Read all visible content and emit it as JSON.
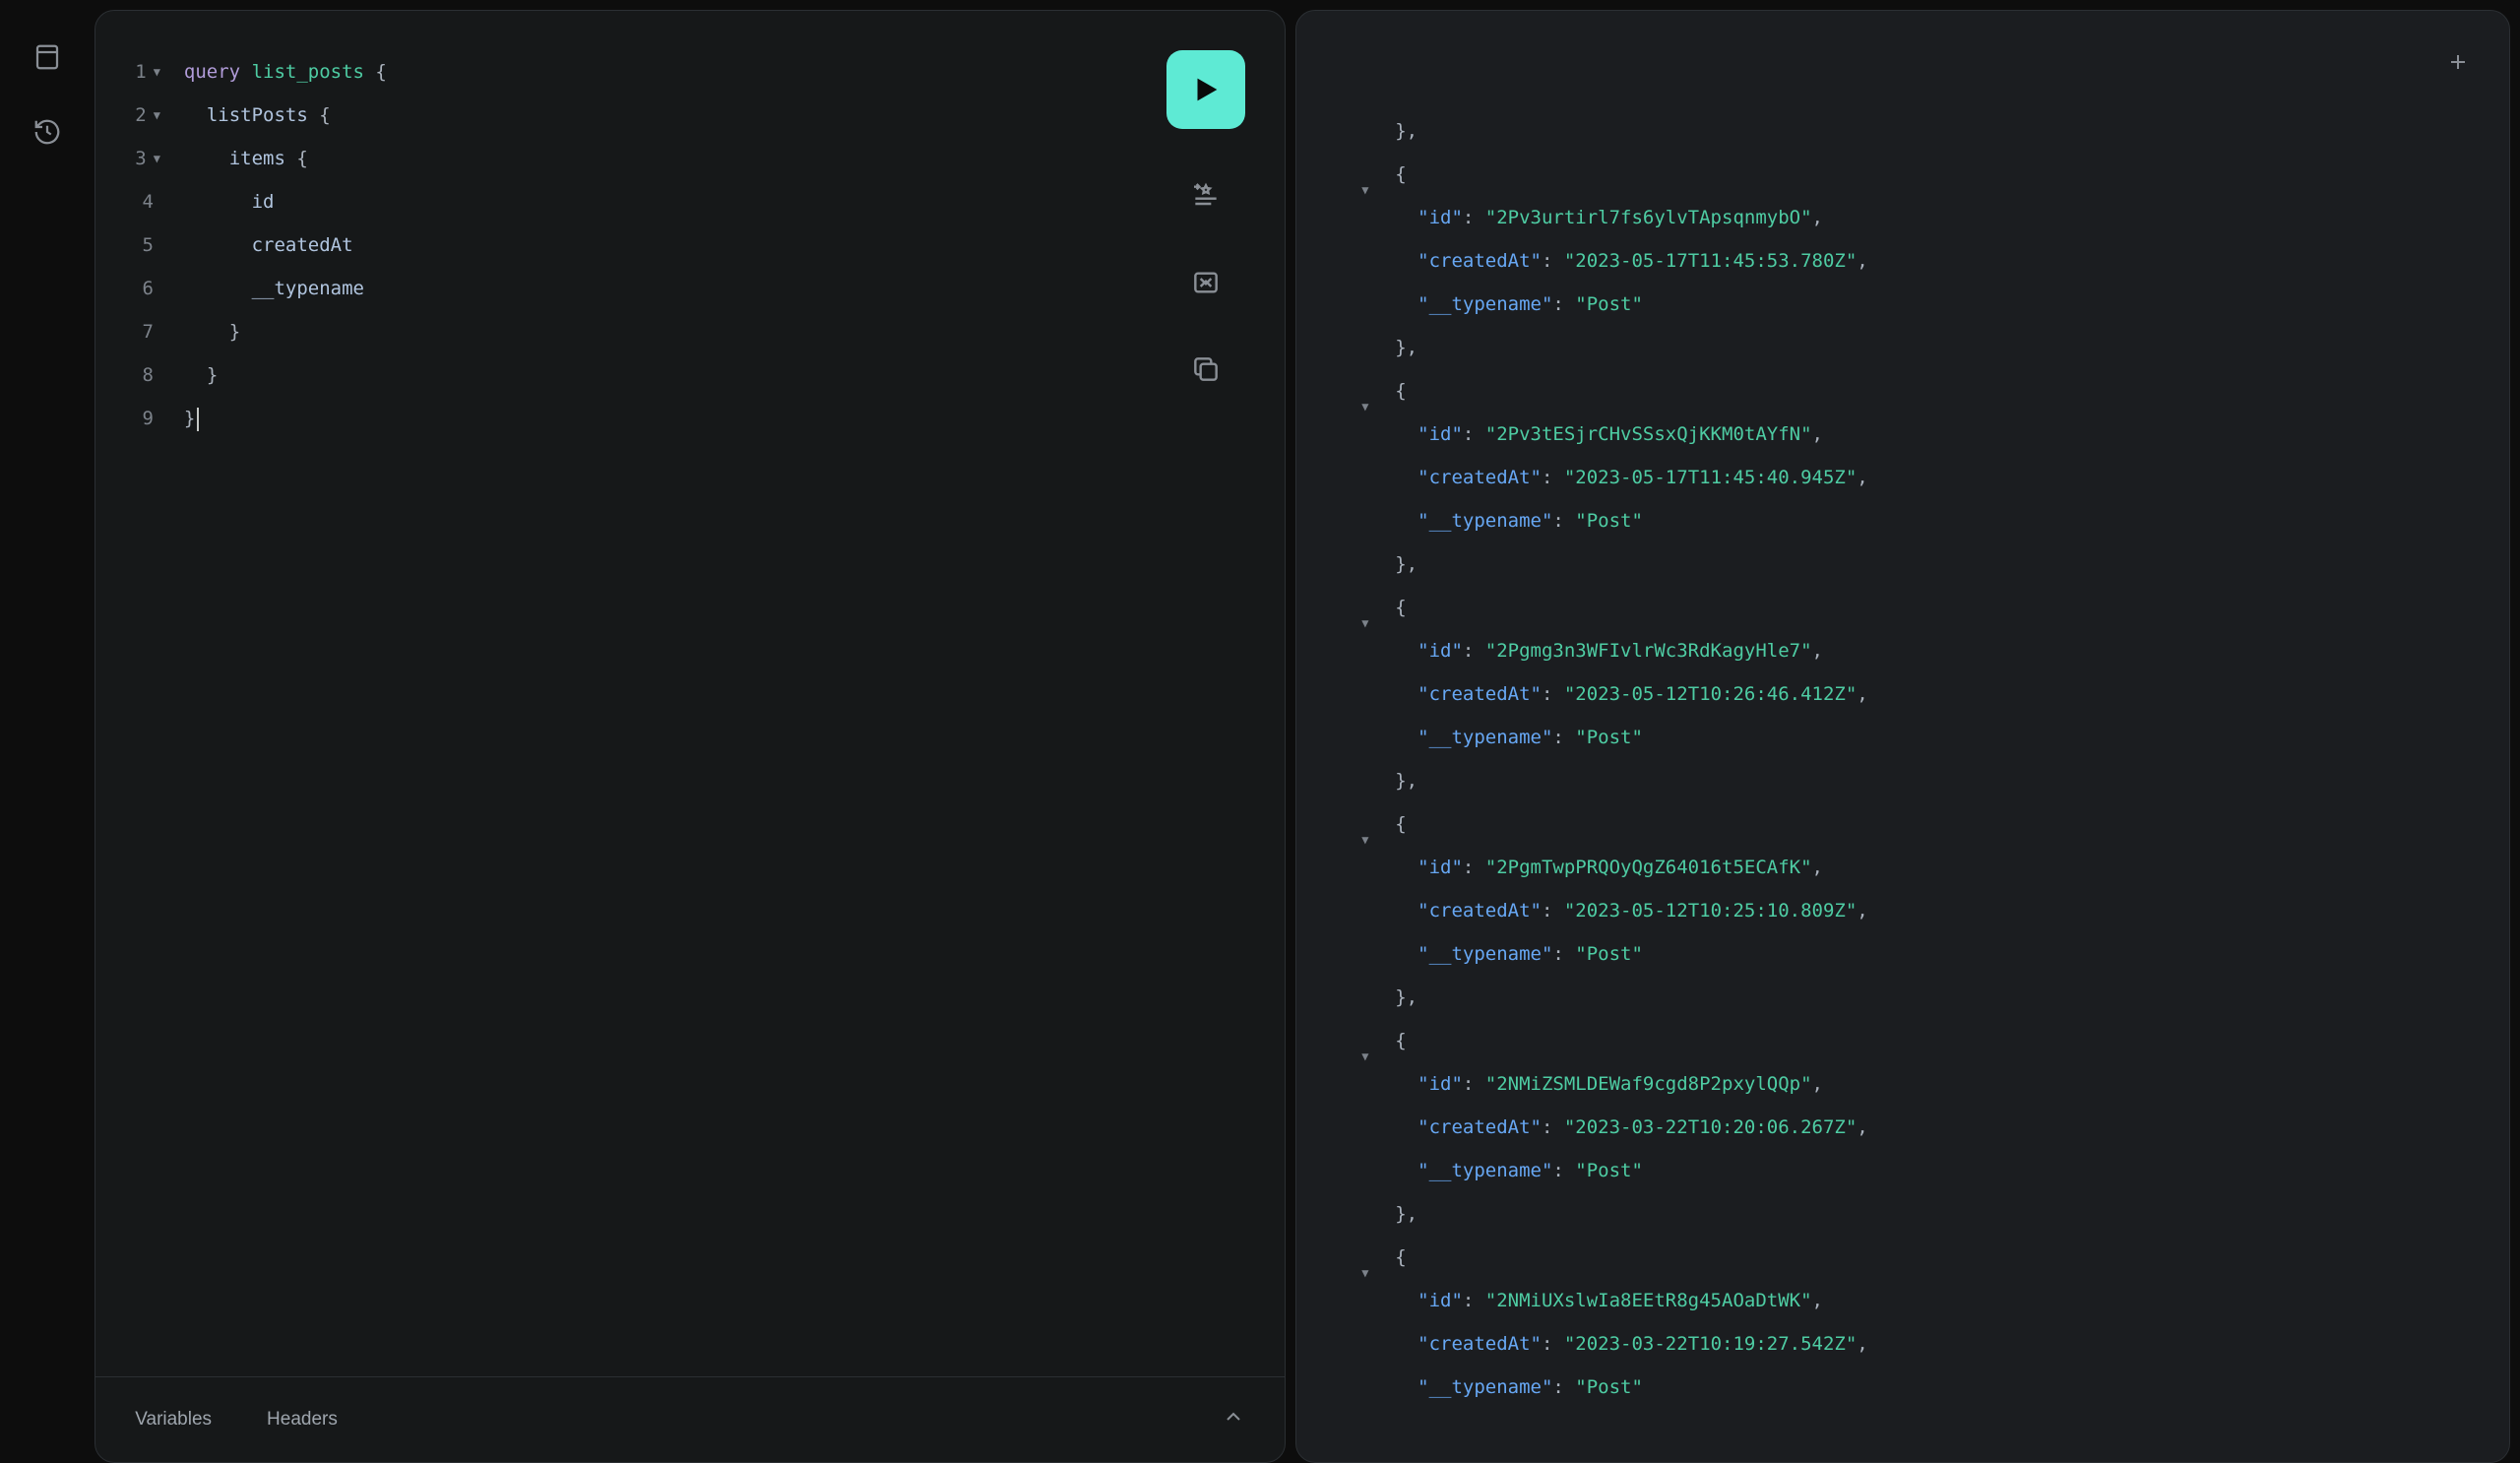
{
  "query_editor": {
    "lines": [
      {
        "num": "1",
        "foldable": true,
        "tokens": [
          [
            "keyword",
            "query"
          ],
          [
            "text",
            " "
          ],
          [
            "name",
            "list_posts"
          ],
          [
            "text",
            " "
          ],
          [
            "punc",
            "{"
          ]
        ]
      },
      {
        "num": "2",
        "foldable": true,
        "tokens": [
          [
            "text",
            "  "
          ],
          [
            "field",
            "listPosts"
          ],
          [
            "text",
            " "
          ],
          [
            "punc",
            "{"
          ]
        ]
      },
      {
        "num": "3",
        "foldable": true,
        "tokens": [
          [
            "text",
            "    "
          ],
          [
            "field",
            "items"
          ],
          [
            "text",
            " "
          ],
          [
            "punc",
            "{"
          ]
        ]
      },
      {
        "num": "4",
        "foldable": false,
        "tokens": [
          [
            "text",
            "      "
          ],
          [
            "field",
            "id"
          ]
        ]
      },
      {
        "num": "5",
        "foldable": false,
        "tokens": [
          [
            "text",
            "      "
          ],
          [
            "field",
            "createdAt"
          ]
        ]
      },
      {
        "num": "6",
        "foldable": false,
        "tokens": [
          [
            "text",
            "      "
          ],
          [
            "field",
            "__typename"
          ]
        ]
      },
      {
        "num": "7",
        "foldable": false,
        "tokens": [
          [
            "text",
            "    "
          ],
          [
            "punc",
            "}"
          ]
        ]
      },
      {
        "num": "8",
        "foldable": false,
        "tokens": [
          [
            "text",
            "  "
          ],
          [
            "punc",
            "}"
          ]
        ]
      },
      {
        "num": "9",
        "foldable": false,
        "tokens": [
          [
            "punc",
            "}"
          ]
        ],
        "cursor": true
      }
    ]
  },
  "bottom_tabs": {
    "variables": "Variables",
    "headers": "Headers"
  },
  "results": {
    "items": [
      {
        "id": "2Pv3urtirl7fs6ylvTApsqnmybO",
        "createdAt": "2023-05-17T11:45:53.780Z",
        "typename": "Post"
      },
      {
        "id": "2Pv3tESjrCHvSSsxQjKKM0tAYfN",
        "createdAt": "2023-05-17T11:45:40.945Z",
        "typename": "Post"
      },
      {
        "id": "2Pgmg3n3WFIvlrWc3RdKagyHle7",
        "createdAt": "2023-05-12T10:26:46.412Z",
        "typename": "Post"
      },
      {
        "id": "2PgmTwpPRQOyQgZ64016t5ECAfK",
        "createdAt": "2023-05-12T10:25:10.809Z",
        "typename": "Post"
      },
      {
        "id": "2NMiZSMLDEWaf9cgd8P2pxylQQp",
        "createdAt": "2023-03-22T10:20:06.267Z",
        "typename": "Post"
      },
      {
        "id": "2NMiUXslwIa8EEtR8g45AOaDtWK",
        "createdAt": "2023-03-22T10:19:27.542Z",
        "typename": "Post"
      }
    ],
    "keys": {
      "id": "id",
      "createdAt": "createdAt",
      "typename": "__typename"
    }
  }
}
